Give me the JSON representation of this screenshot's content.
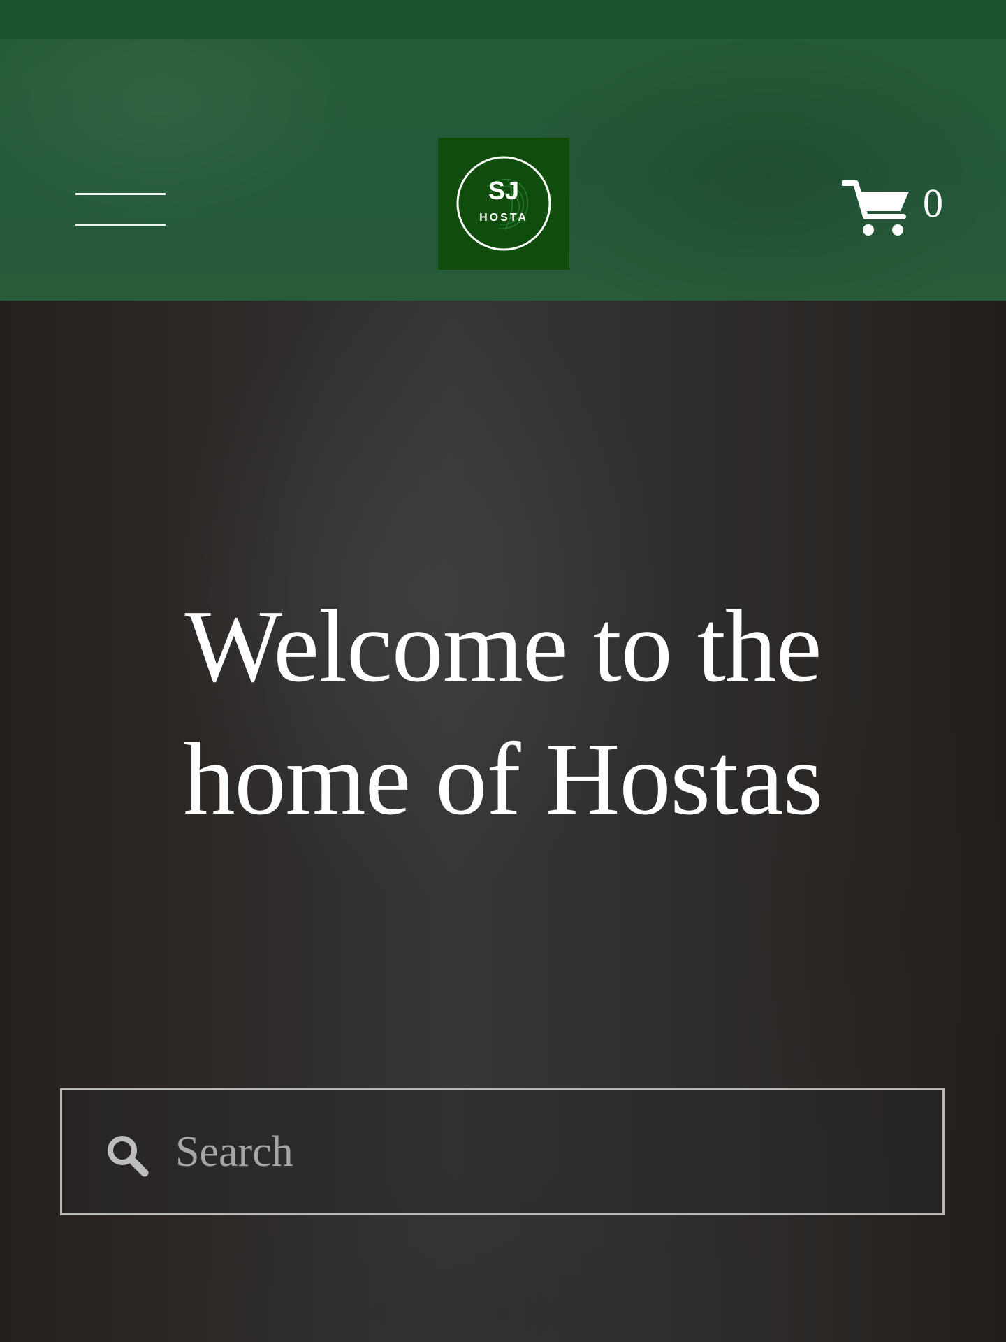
{
  "colors": {
    "header_green": "#255a36",
    "status_strip": "#1c5431",
    "logo_background": "#104d0c",
    "hero_background": "#2c2826",
    "text": "#ffffff",
    "search_border": "#b7b7b7"
  },
  "header": {
    "menu_icon": "hamburger-menu-icon",
    "logo": {
      "line1": "SJ",
      "line2": "HOSTA"
    },
    "cart": {
      "icon": "shopping-cart-icon",
      "count": "0"
    }
  },
  "hero": {
    "title": "Welcome to the home of Hostas"
  },
  "search": {
    "icon": "search-icon",
    "placeholder": "Search",
    "value": ""
  }
}
